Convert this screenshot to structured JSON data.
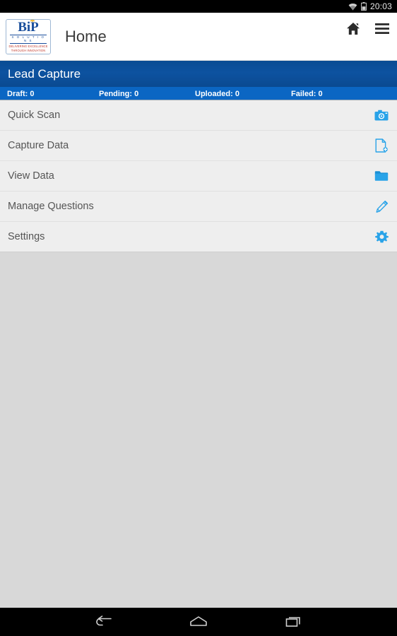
{
  "status_bar": {
    "time": "20:03",
    "icons": [
      "wifi-icon",
      "battery-icon"
    ]
  },
  "app_bar": {
    "title": "Home",
    "logo": {
      "brand": "BiP",
      "subtitle": "S O L U T I O N S",
      "tagline_line1": "DELIVERING EXCELLENCE",
      "tagline_line2": "THROUGH INNOVATION"
    },
    "actions": [
      {
        "name": "home-icon",
        "label": "Home"
      },
      {
        "name": "menu-icon",
        "label": "Menu"
      }
    ]
  },
  "section": {
    "title": "Lead Capture",
    "title_bar_color": "#0d52a0",
    "stats_bar_color": "#0b66c3",
    "stats": [
      {
        "label": "Draft: 0"
      },
      {
        "label": "Pending: 0"
      },
      {
        "label": "Uploaded: 0"
      },
      {
        "label": "Failed: 0"
      }
    ]
  },
  "menu": {
    "accent_color": "#29a3e8",
    "items": [
      {
        "label": "Quick Scan",
        "icon": "camera-icon"
      },
      {
        "label": "Capture Data",
        "icon": "document-add-icon"
      },
      {
        "label": "View Data",
        "icon": "folder-icon"
      },
      {
        "label": "Manage Questions",
        "icon": "pencil-icon"
      },
      {
        "label": "Settings",
        "icon": "gear-icon"
      }
    ]
  },
  "nav_bar": {
    "buttons": [
      {
        "name": "back-button",
        "label": "Back"
      },
      {
        "name": "home-button",
        "label": "Home"
      },
      {
        "name": "recents-button",
        "label": "Recent apps"
      }
    ]
  }
}
